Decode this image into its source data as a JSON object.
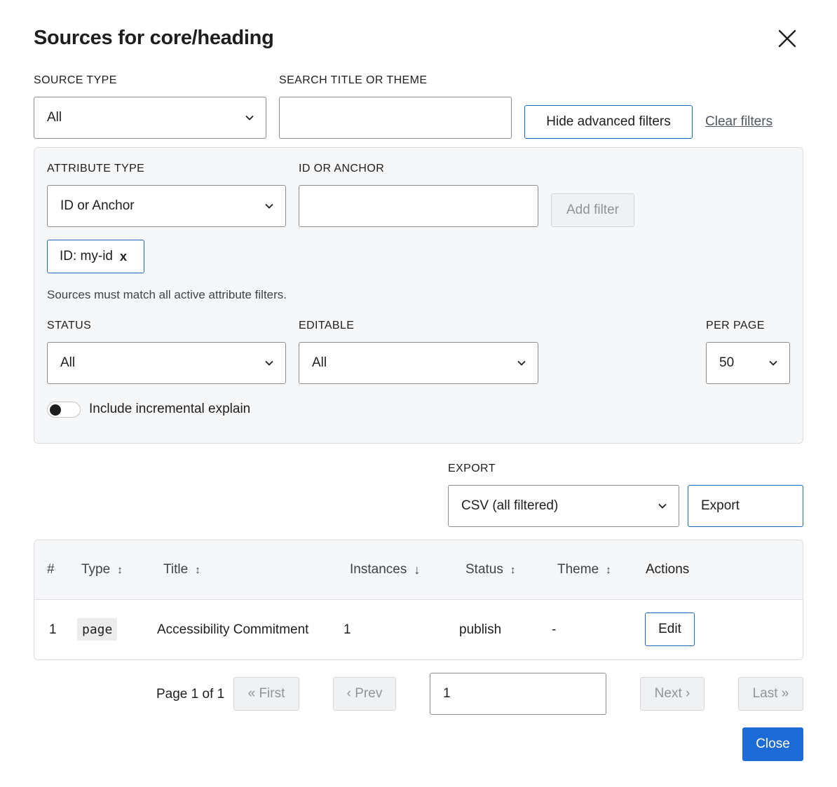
{
  "dialog": {
    "title": "Sources for core/heading",
    "close_icon": "close-icon"
  },
  "filters": {
    "source_type": {
      "label": "SOURCE TYPE",
      "value": "All"
    },
    "search": {
      "label": "SEARCH TITLE OR THEME",
      "value": "",
      "placeholder": ""
    },
    "hide_advanced_label": "Hide advanced filters",
    "clear_filters_label": "Clear filters"
  },
  "advanced": {
    "attribute_type": {
      "label": "ATTRIBUTE TYPE",
      "value": "ID or Anchor"
    },
    "id_or_anchor": {
      "label": "ID OR ANCHOR",
      "value": ""
    },
    "add_filter_label": "Add filter",
    "active_chip": {
      "label": "ID: my-id",
      "remove": "x"
    },
    "hint": "Sources must match all active attribute filters.",
    "status": {
      "label": "STATUS",
      "value": "All"
    },
    "editable": {
      "label": "EDITABLE",
      "value": "All"
    },
    "per_page": {
      "label": "PER PAGE",
      "value": "50"
    },
    "incremental_toggle": {
      "label": "Include incremental explain",
      "on": false
    }
  },
  "export": {
    "label": "EXPORT",
    "format": "CSV (all filtered)",
    "button_label": "Export"
  },
  "table": {
    "headers": {
      "num": "#",
      "type": "Type",
      "title": "Title",
      "instances": "Instances",
      "status": "Status",
      "theme": "Theme",
      "actions": "Actions"
    },
    "sort_icons": {
      "type": "↕",
      "title": "↕",
      "instances": "↓",
      "status": "↕",
      "theme": "↕"
    },
    "rows": [
      {
        "num": "1",
        "type": "page",
        "title": "Accessibility Commitment",
        "instances": "1",
        "status": "publish",
        "theme": "-",
        "action": "Edit"
      }
    ]
  },
  "pagination": {
    "info": "Page 1 of 1",
    "first": "« First",
    "prev": "‹ Prev",
    "page_input": "1",
    "next": "Next ›",
    "last": "Last »"
  },
  "footer": {
    "close_label": "Close"
  },
  "colors": {
    "accent": "#1d6bb5",
    "primary": "#1d6bd6",
    "panel_bg": "#f6f7f8"
  }
}
